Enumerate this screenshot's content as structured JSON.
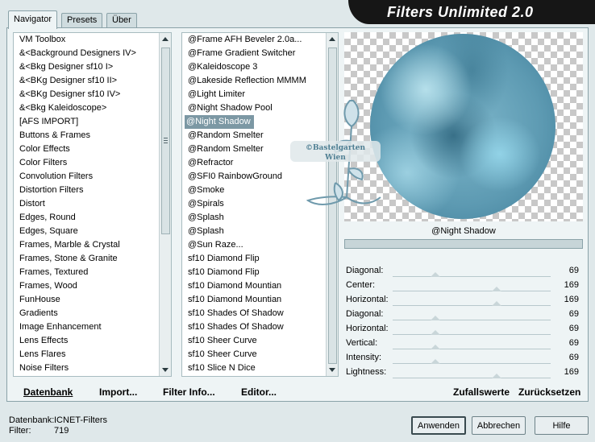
{
  "tabs": [
    "Navigator",
    "Presets",
    "Über"
  ],
  "app_title": "Filters Unlimited 2.0",
  "categories": [
    "VM Toolbox",
    "&<Background Designers IV>",
    "&<Bkg Designer sf10 I>",
    "&<BKg Designer sf10 II>",
    "&<BKg Designer sf10 IV>",
    "&<Bkg Kaleidoscope>",
    "[AFS IMPORT]",
    "Buttons & Frames",
    "Color Effects",
    "Color Filters",
    "Convolution Filters",
    "Distortion Filters",
    "Distort",
    "Edges, Round",
    "Edges, Square",
    "Frames, Marble & Crystal",
    "Frames, Stone & Granite",
    "Frames, Textured",
    "Frames, Wood",
    "FunHouse",
    "Gradients",
    "Image Enhancement",
    "Lens Effects",
    "Lens Flares",
    "Noise Filters"
  ],
  "filters": [
    "@Frame AFH Beveler 2.0a...",
    "@Frame Gradient Switcher",
    "@Kaleidoscope 3",
    "@Lakeside Reflection MMMM",
    "@Light Limiter",
    "@Night Shadow Pool",
    "@Night Shadow",
    "@Random Smelter",
    "@Random Smelter",
    "@Refractor",
    "@SFI0 RainbowGround",
    "@Smoke",
    "@Spirals",
    "@Splash",
    "@Splash",
    "@Sun Raze...",
    "sf10 Diamond Flip",
    "sf10 Diamond Flip",
    "sf10 Diamond Mountian",
    "sf10 Diamond Mountian",
    "sf10 Shades Of Shadow",
    "sf10 Shades Of Shadow",
    "sf10 Sheer Curve",
    "sf10 Sheer Curve",
    "sf10 Slice N Dice"
  ],
  "selected_filter_index": 6,
  "buttons": {
    "datenbank": "Datenbank",
    "import": "Import...",
    "filter_info": "Filter Info...",
    "editor": "Editor...",
    "zufallswerte": "Zufallswerte",
    "zuruecksetzen": "Zurücksetzen",
    "anwenden": "Anwenden",
    "abbrechen": "Abbrechen",
    "hilfe": "Hilfe"
  },
  "preview_title": "@Night Shadow",
  "params": [
    {
      "label": "Diagonal:",
      "value": "69",
      "level": 0.27
    },
    {
      "label": "Center:",
      "value": "169",
      "level": 0.66
    },
    {
      "label": "Horizontal:",
      "value": "169",
      "level": 0.66
    },
    {
      "label": "Diagonal:",
      "value": "69",
      "level": 0.27
    },
    {
      "label": "Horizontal:",
      "value": "69",
      "level": 0.27
    },
    {
      "label": "Vertical:",
      "value": "69",
      "level": 0.27
    },
    {
      "label": "Intensity:",
      "value": "69",
      "level": 0.27
    },
    {
      "label": "Lightness:",
      "value": "169",
      "level": 0.66
    }
  ],
  "status": {
    "db_label": "Datenbank:",
    "db_value": "ICNET-Filters",
    "filter_label": "Filter:",
    "filter_value": "719"
  },
  "watermark": {
    "line1": "©Bastelgarten",
    "line2": "Wien"
  }
}
